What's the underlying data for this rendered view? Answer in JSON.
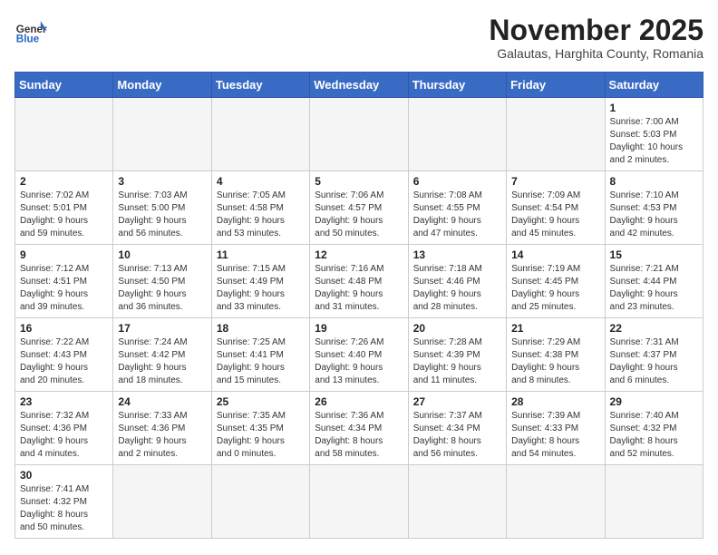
{
  "header": {
    "logo_general": "General",
    "logo_blue": "Blue",
    "title": "November 2025",
    "subtitle": "Galautas, Harghita County, Romania"
  },
  "days_of_week": [
    "Sunday",
    "Monday",
    "Tuesday",
    "Wednesday",
    "Thursday",
    "Friday",
    "Saturday"
  ],
  "weeks": [
    [
      {
        "day": "",
        "info": ""
      },
      {
        "day": "",
        "info": ""
      },
      {
        "day": "",
        "info": ""
      },
      {
        "day": "",
        "info": ""
      },
      {
        "day": "",
        "info": ""
      },
      {
        "day": "",
        "info": ""
      },
      {
        "day": "1",
        "info": "Sunrise: 7:00 AM\nSunset: 5:03 PM\nDaylight: 10 hours\nand 2 minutes."
      }
    ],
    [
      {
        "day": "2",
        "info": "Sunrise: 7:02 AM\nSunset: 5:01 PM\nDaylight: 9 hours\nand 59 minutes."
      },
      {
        "day": "3",
        "info": "Sunrise: 7:03 AM\nSunset: 5:00 PM\nDaylight: 9 hours\nand 56 minutes."
      },
      {
        "day": "4",
        "info": "Sunrise: 7:05 AM\nSunset: 4:58 PM\nDaylight: 9 hours\nand 53 minutes."
      },
      {
        "day": "5",
        "info": "Sunrise: 7:06 AM\nSunset: 4:57 PM\nDaylight: 9 hours\nand 50 minutes."
      },
      {
        "day": "6",
        "info": "Sunrise: 7:08 AM\nSunset: 4:55 PM\nDaylight: 9 hours\nand 47 minutes."
      },
      {
        "day": "7",
        "info": "Sunrise: 7:09 AM\nSunset: 4:54 PM\nDaylight: 9 hours\nand 45 minutes."
      },
      {
        "day": "8",
        "info": "Sunrise: 7:10 AM\nSunset: 4:53 PM\nDaylight: 9 hours\nand 42 minutes."
      }
    ],
    [
      {
        "day": "9",
        "info": "Sunrise: 7:12 AM\nSunset: 4:51 PM\nDaylight: 9 hours\nand 39 minutes."
      },
      {
        "day": "10",
        "info": "Sunrise: 7:13 AM\nSunset: 4:50 PM\nDaylight: 9 hours\nand 36 minutes."
      },
      {
        "day": "11",
        "info": "Sunrise: 7:15 AM\nSunset: 4:49 PM\nDaylight: 9 hours\nand 33 minutes."
      },
      {
        "day": "12",
        "info": "Sunrise: 7:16 AM\nSunset: 4:48 PM\nDaylight: 9 hours\nand 31 minutes."
      },
      {
        "day": "13",
        "info": "Sunrise: 7:18 AM\nSunset: 4:46 PM\nDaylight: 9 hours\nand 28 minutes."
      },
      {
        "day": "14",
        "info": "Sunrise: 7:19 AM\nSunset: 4:45 PM\nDaylight: 9 hours\nand 25 minutes."
      },
      {
        "day": "15",
        "info": "Sunrise: 7:21 AM\nSunset: 4:44 PM\nDaylight: 9 hours\nand 23 minutes."
      }
    ],
    [
      {
        "day": "16",
        "info": "Sunrise: 7:22 AM\nSunset: 4:43 PM\nDaylight: 9 hours\nand 20 minutes."
      },
      {
        "day": "17",
        "info": "Sunrise: 7:24 AM\nSunset: 4:42 PM\nDaylight: 9 hours\nand 18 minutes."
      },
      {
        "day": "18",
        "info": "Sunrise: 7:25 AM\nSunset: 4:41 PM\nDaylight: 9 hours\nand 15 minutes."
      },
      {
        "day": "19",
        "info": "Sunrise: 7:26 AM\nSunset: 4:40 PM\nDaylight: 9 hours\nand 13 minutes."
      },
      {
        "day": "20",
        "info": "Sunrise: 7:28 AM\nSunset: 4:39 PM\nDaylight: 9 hours\nand 11 minutes."
      },
      {
        "day": "21",
        "info": "Sunrise: 7:29 AM\nSunset: 4:38 PM\nDaylight: 9 hours\nand 8 minutes."
      },
      {
        "day": "22",
        "info": "Sunrise: 7:31 AM\nSunset: 4:37 PM\nDaylight: 9 hours\nand 6 minutes."
      }
    ],
    [
      {
        "day": "23",
        "info": "Sunrise: 7:32 AM\nSunset: 4:36 PM\nDaylight: 9 hours\nand 4 minutes."
      },
      {
        "day": "24",
        "info": "Sunrise: 7:33 AM\nSunset: 4:36 PM\nDaylight: 9 hours\nand 2 minutes."
      },
      {
        "day": "25",
        "info": "Sunrise: 7:35 AM\nSunset: 4:35 PM\nDaylight: 9 hours\nand 0 minutes."
      },
      {
        "day": "26",
        "info": "Sunrise: 7:36 AM\nSunset: 4:34 PM\nDaylight: 8 hours\nand 58 minutes."
      },
      {
        "day": "27",
        "info": "Sunrise: 7:37 AM\nSunset: 4:34 PM\nDaylight: 8 hours\nand 56 minutes."
      },
      {
        "day": "28",
        "info": "Sunrise: 7:39 AM\nSunset: 4:33 PM\nDaylight: 8 hours\nand 54 minutes."
      },
      {
        "day": "29",
        "info": "Sunrise: 7:40 AM\nSunset: 4:32 PM\nDaylight: 8 hours\nand 52 minutes."
      }
    ],
    [
      {
        "day": "30",
        "info": "Sunrise: 7:41 AM\nSunset: 4:32 PM\nDaylight: 8 hours\nand 50 minutes."
      },
      {
        "day": "",
        "info": ""
      },
      {
        "day": "",
        "info": ""
      },
      {
        "day": "",
        "info": ""
      },
      {
        "day": "",
        "info": ""
      },
      {
        "day": "",
        "info": ""
      },
      {
        "day": "",
        "info": ""
      }
    ]
  ]
}
